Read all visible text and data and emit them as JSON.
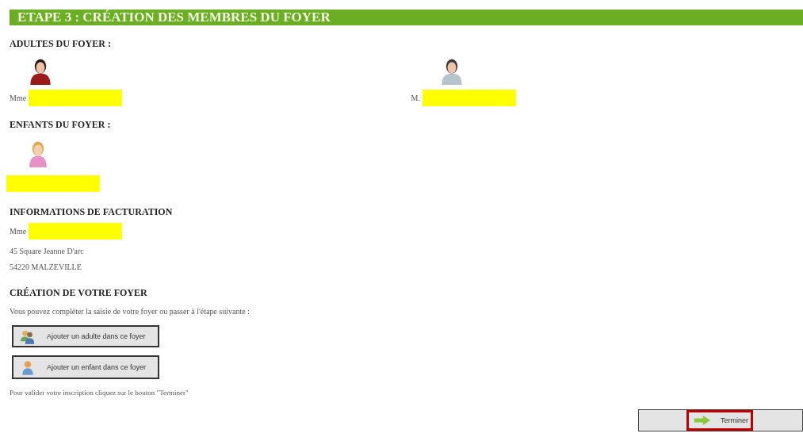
{
  "title": "ETAPE 3 : CRÉATION DES MEMBRES DU FOYER",
  "adults": {
    "heading": "ADULTES DU FOYER :",
    "members": [
      {
        "kind": "woman",
        "civility": "Mme",
        "redacted": true
      },
      {
        "kind": "man",
        "civility": "M.",
        "redacted": true
      }
    ]
  },
  "children": {
    "heading": "ENFANTS DU FOYER :",
    "members": [
      {
        "kind": "girl",
        "redacted": true
      }
    ]
  },
  "billing": {
    "heading": "INFORMATIONS DE FACTURATION",
    "civility": "Mme",
    "redacted": true,
    "address_lines": [
      "45 Square Jeanne D'arc",
      "54220 MALZEVILLE"
    ]
  },
  "creation": {
    "heading": "CRÉATION DE VOTRE FOYER",
    "intro": "Vous pouvez compléter la saisie de votre foyer ou passer à l'étape suivante :",
    "buttons": [
      {
        "kind": "adult",
        "label": "Ajouter un adulte dans ce foyer"
      },
      {
        "kind": "child",
        "label": "Ajouter un enfant dans ce foyer"
      }
    ],
    "note": "Pour valider votre inscription cliquez sur le bouton \"Terminer\""
  },
  "finish_button": {
    "label": "Terminer",
    "highlighted": true
  }
}
